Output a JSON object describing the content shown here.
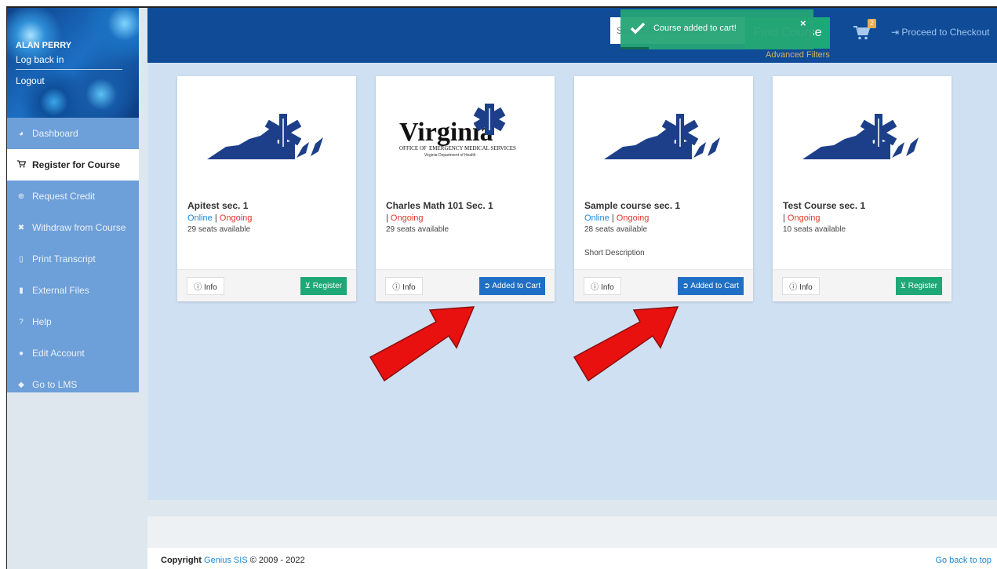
{
  "user": {
    "name": "ALAN PERRY",
    "log_back": "Log back in",
    "logout": "Logout"
  },
  "nav": [
    {
      "label": "Dashboard",
      "icon": "dashboard-icon",
      "active": false
    },
    {
      "label": "Register for Course",
      "icon": "cart-icon",
      "active": true
    },
    {
      "label": "Request Credit",
      "icon": "plus-circle-icon",
      "active": false
    },
    {
      "label": "Withdraw from Course",
      "icon": "x-icon",
      "active": false
    },
    {
      "label": "Print Transcript",
      "icon": "pdf-file-icon",
      "active": false
    },
    {
      "label": "External Files",
      "icon": "file-icon",
      "active": false
    },
    {
      "label": "Help",
      "icon": "question-icon",
      "active": false
    },
    {
      "label": "Edit Account",
      "icon": "user-icon",
      "active": false
    },
    {
      "label": "Go to LMS",
      "icon": "graduation-cap-icon",
      "active": false
    }
  ],
  "header": {
    "search_placeholder": "Search for Courses...",
    "find_label": "Find Course",
    "advanced_filters": "Advanced Filters",
    "cart_count": "2",
    "checkout_label": "Proceed to Checkout"
  },
  "toast": {
    "message": "Course added to cart!",
    "close": "×"
  },
  "cards": [
    {
      "title": "Apitest sec. 1",
      "online": "Online",
      "sep": "|",
      "status": "Ongoing",
      "seats": "29 seats available",
      "desc": "",
      "info": "Info",
      "action": "Register",
      "action_type": "register",
      "logo": "virginia-state-logo"
    },
    {
      "title": "Charles Math 101 Sec. 1",
      "online": "",
      "sep": "|",
      "status": "Ongoing",
      "seats": "29 seats available",
      "desc": "",
      "info": "Info",
      "action": "Added to Cart",
      "action_type": "cart",
      "logo": "virginia-oems-logo"
    },
    {
      "title": "Sample course sec. 1",
      "online": "Online",
      "sep": "|",
      "status": "Ongoing",
      "seats": "28 seats available",
      "desc": "Short Description",
      "info": "Info",
      "action": "Added to Cart",
      "action_type": "cart",
      "logo": "virginia-state-logo"
    },
    {
      "title": "Test Course sec. 1",
      "online": "",
      "sep": "|",
      "status": "Ongoing",
      "seats": "10 seats available",
      "desc": "",
      "info": "Info",
      "action": "Register",
      "action_type": "register",
      "logo": "virginia-state-logo"
    }
  ],
  "logo_text": {
    "big": "Virginia",
    "office": "OFFICE OF",
    "ems": "EMERGENCY MEDICAL SERVICES",
    "dept": "Virginia Department of Health"
  },
  "footer": {
    "copyright": "Copyright",
    "brand": "Genius SIS",
    "years": "© 2009 - 2022",
    "go_top": "Go back to top"
  },
  "colors": {
    "header": "#0f4b96",
    "sidebar": "#6d9fd8",
    "content": "#cfe0f3",
    "accent_green": "#1ea876",
    "accent_blue": "#1f6fc4",
    "arrow_red": "#e8110f"
  }
}
